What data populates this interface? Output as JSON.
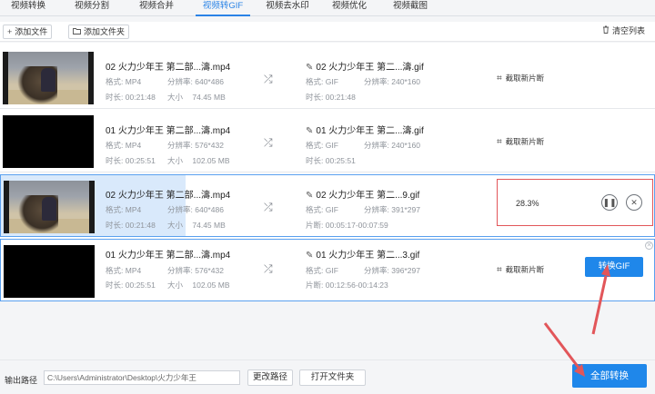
{
  "tabs": [
    {
      "label": "视频转换"
    },
    {
      "label": "视频分割"
    },
    {
      "label": "视频合并"
    },
    {
      "label": "视频转GIF"
    },
    {
      "label": "视频去水印"
    },
    {
      "label": "视频优化"
    },
    {
      "label": "视频截图"
    }
  ],
  "active_tab": "视频转GIF",
  "toolbar": {
    "add_file": "添加文件",
    "add_folder": "添加文件夹",
    "clear_list": "清空列表"
  },
  "labels": {
    "format": "格式:",
    "resolution": "分辨率:",
    "duration": "时长:",
    "size": "大小",
    "segment": "片断:",
    "clip": "截取新片断",
    "convert_gif": "转换GIF"
  },
  "rows": [
    {
      "src_name": "02 火力少年王 第二部...濤.mp4",
      "src_format": "MP4",
      "src_resolution": "640*486",
      "src_duration": "00:21:48",
      "src_size": "74.45 MB",
      "out_name": "02 火力少年王 第二...濤.gif",
      "out_format": "GIF",
      "out_resolution": "240*160",
      "out_time_label": "时长:",
      "out_time": "00:21:48"
    },
    {
      "src_name": "01 火力少年王 第二部...濤.mp4",
      "src_format": "MP4",
      "src_resolution": "576*432",
      "src_duration": "00:25:51",
      "src_size": "102.05 MB",
      "out_name": "01 火力少年王 第二...濤.gif",
      "out_format": "GIF",
      "out_resolution": "240*160",
      "out_time_label": "时长:",
      "out_time": "00:25:51"
    },
    {
      "src_name": "02 火力少年王 第二部...濤.mp4",
      "src_format": "MP4",
      "src_resolution": "640*486",
      "src_duration": "00:21:48",
      "src_size": "74.45 MB",
      "out_name": "02 火力少年王 第二...9.gif",
      "out_format": "GIF",
      "out_resolution": "391*297",
      "out_time_label": "片断:",
      "out_time": "00:05:17-00:07:59",
      "progress_text": "28.3%",
      "progress": 0.283
    },
    {
      "src_name": "01 火力少年王 第二部...濤.mp4",
      "src_format": "MP4",
      "src_resolution": "576*432",
      "src_duration": "00:25:51",
      "src_size": "102.05 MB",
      "out_name": "01 火力少年王 第二...3.gif",
      "out_format": "GIF",
      "out_resolution": "396*297",
      "out_time_label": "片断:",
      "out_time": "00:12:56-00:14:23"
    }
  ],
  "footer": {
    "output_label": "输出路径",
    "output_path": "C:\\Users\\Administrator\\Desktop\\火力少年王",
    "change_path": "更改路径",
    "open_folder": "打开文件夹",
    "convert_all": "全部转换"
  },
  "colors": {
    "accent": "#1f87ea",
    "annotation": "#e2565a",
    "selection": "#d9e9fb"
  },
  "icons": {
    "add": "plus-icon",
    "folder": "folder-icon",
    "clear": "trash-icon",
    "swap": "shuffle-icon",
    "edit": "pencil-icon",
    "crop": "crop-icon",
    "pause": "pause-icon",
    "cancel": "close-icon"
  }
}
